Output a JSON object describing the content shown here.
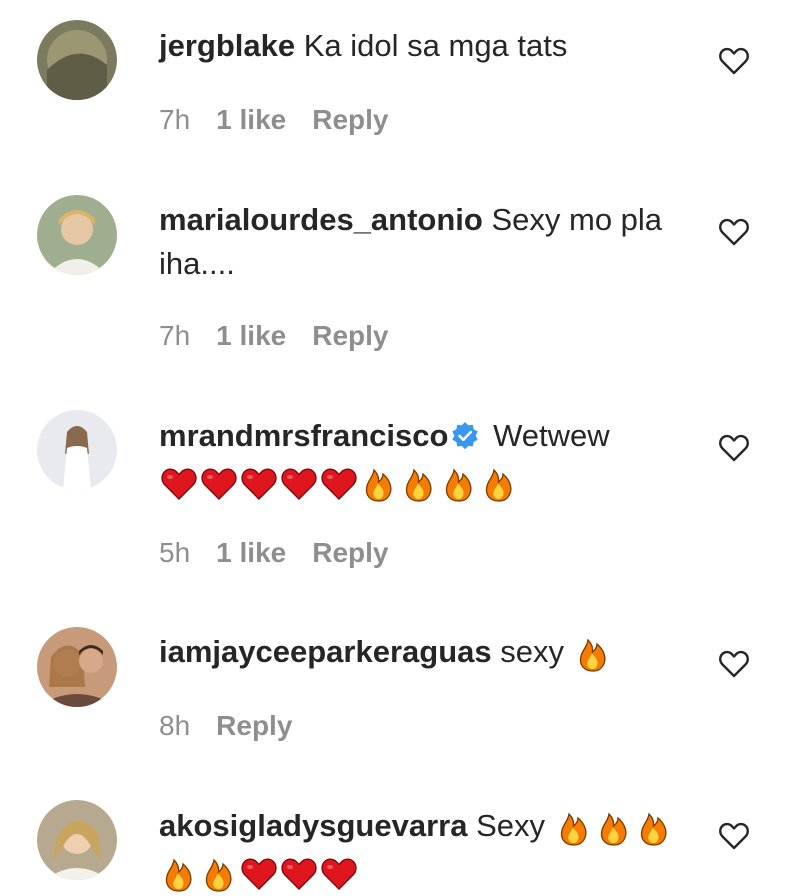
{
  "comments": [
    {
      "username": "jergblake",
      "text": " Ka idol sa mga tats",
      "emojis": [],
      "time": "7h",
      "likes": "1 like",
      "reply": "Reply",
      "avatar": "avatar-jergblake",
      "like_icon": "heart-outline-icon"
    },
    {
      "username": "marialourdes_antonio",
      "text": " Sexy mo pla iha....",
      "emojis": [],
      "time": "7h",
      "likes": "1 like",
      "reply": "Reply",
      "avatar": "avatar-marialourdes",
      "like_icon": "heart-outline-icon"
    },
    {
      "username": "mrandmrsfrancisco",
      "verified": true,
      "text": " Wetwew",
      "emojis": [
        "red-heart",
        "red-heart",
        "red-heart",
        "red-heart",
        "red-heart",
        "fire",
        "fire",
        "fire",
        "fire"
      ],
      "time": "5h",
      "likes": "1 like",
      "reply": "Reply",
      "avatar": "avatar-mrandmrsfrancisco",
      "like_icon": "heart-outline-icon"
    },
    {
      "username": "iamjayceeparkeraguas",
      "text": " sexy ",
      "emojis": [
        "fire"
      ],
      "time": "8h",
      "likes": "",
      "reply": "Reply",
      "avatar": "avatar-iamjayceeparkeraguas",
      "like_icon": "heart-outline-icon"
    },
    {
      "username": "akosigladysguevarra",
      "text": " Sexy ",
      "emojis": [
        "fire",
        "fire",
        "fire",
        "fire",
        "fire",
        "red-heart",
        "red-heart",
        "red-heart"
      ],
      "time": "",
      "likes": "",
      "reply": "",
      "avatar": "avatar-akosigladysguevarra",
      "like_icon": "heart-outline-icon"
    }
  ],
  "colors": {
    "text": "#262626",
    "meta": "#8e8e8e",
    "verified": "#3897f0",
    "heart": "#e0161e",
    "fire": "#f57c00"
  }
}
